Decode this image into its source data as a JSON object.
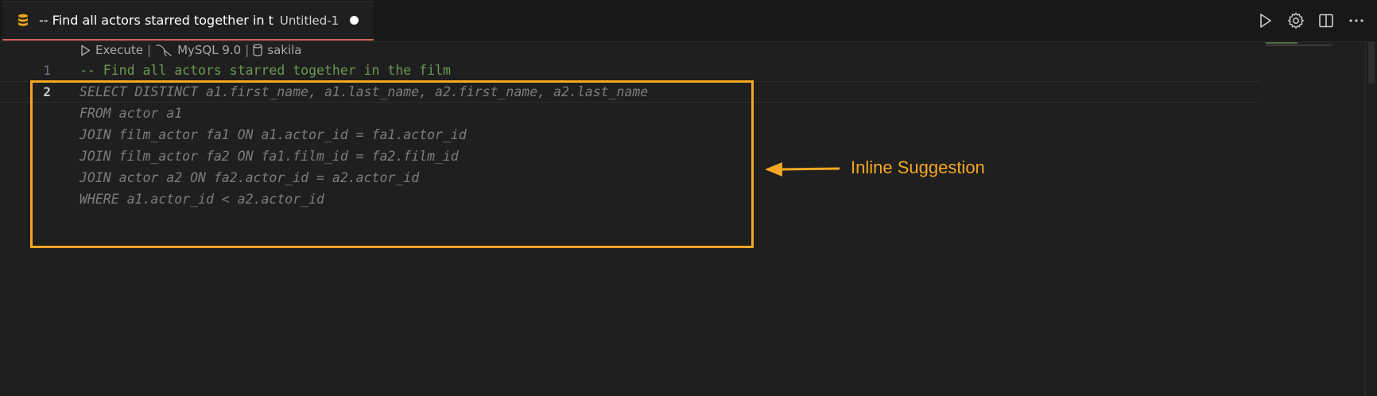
{
  "tab": {
    "title": "-- Find all actors starred together in t",
    "subtitle": "Untitled-1",
    "icon": "database-icon"
  },
  "toolbar": {
    "icons": [
      "run-icon",
      "settings-icon",
      "split-editor-icon",
      "more-actions-icon"
    ]
  },
  "codelens": {
    "execute": "Execute",
    "connection": "MySQL 9.0",
    "database": "sakila",
    "separator": "|"
  },
  "editor": {
    "lines": [
      {
        "number": "1",
        "text": "-- Find all actors starred together in the film",
        "kind": "comment"
      },
      {
        "number": "2",
        "text": "SELECT DISTINCT a1.first_name, a1.last_name, a2.first_name, a2.last_name",
        "kind": "ghost"
      },
      {
        "number": "",
        "text": "FROM actor a1",
        "kind": "ghost"
      },
      {
        "number": "",
        "text": "JOIN film_actor fa1 ON a1.actor_id = fa1.actor_id",
        "kind": "ghost"
      },
      {
        "number": "",
        "text": "JOIN film_actor fa2 ON fa1.film_id = fa2.film_id",
        "kind": "ghost"
      },
      {
        "number": "",
        "text": "JOIN actor a2 ON fa2.actor_id = a2.actor_id",
        "kind": "ghost"
      },
      {
        "number": "",
        "text": "WHERE a1.actor_id < a2.actor_id",
        "kind": "ghost"
      }
    ]
  },
  "annotation": {
    "label": "Inline Suggestion",
    "color": "#f5a623"
  },
  "colors": {
    "tab_accent": "#d1655b",
    "comment": "#6a9955",
    "ghost_text": "#7d7d7d",
    "database_icon": "#e8a21a"
  }
}
